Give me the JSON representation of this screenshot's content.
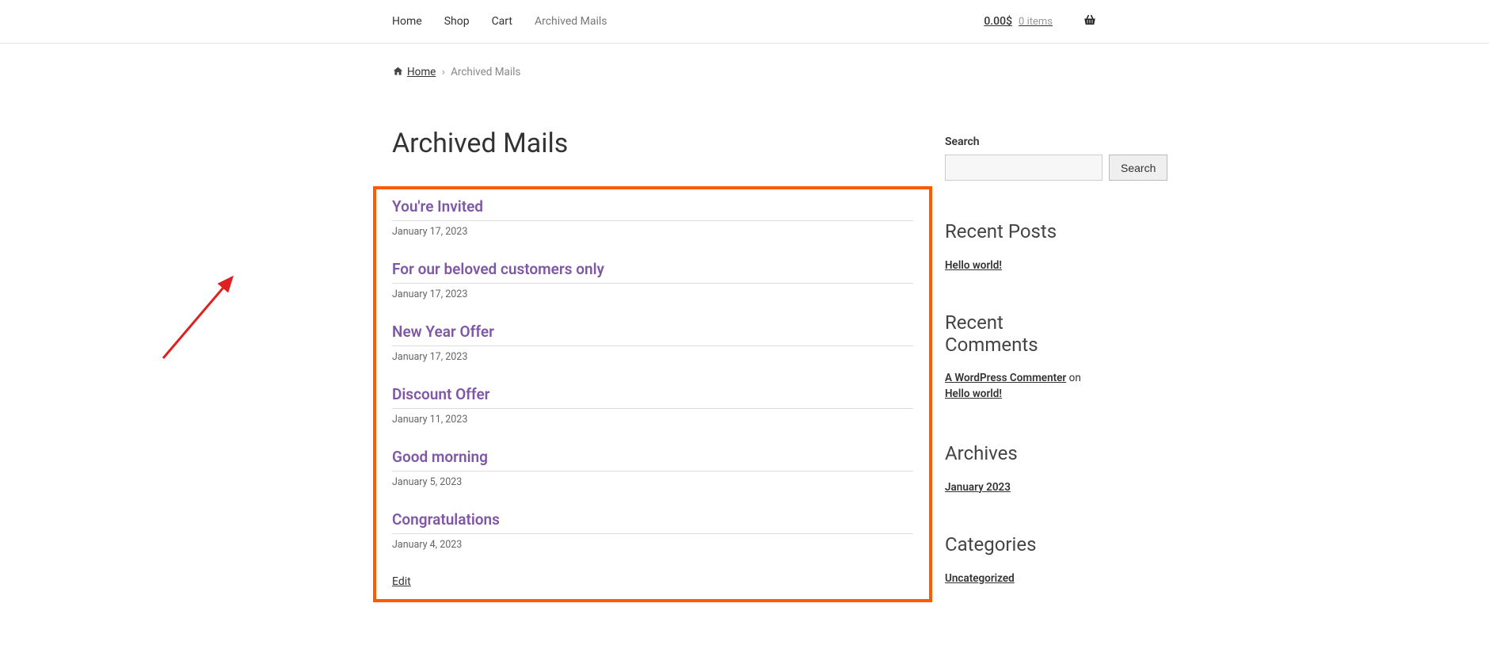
{
  "nav": {
    "home": "Home",
    "shop": "Shop",
    "cart": "Cart",
    "archived_mails": "Archived Mails"
  },
  "cart": {
    "amount": "0.00$",
    "items": "0 items"
  },
  "breadcrumb": {
    "home": "Home",
    "current": "Archived Mails"
  },
  "page_title": "Archived Mails",
  "posts": [
    {
      "title": "You're Invited",
      "date": "January 17, 2023"
    },
    {
      "title": "For our beloved customers only",
      "date": "January 17, 2023"
    },
    {
      "title": "New Year Offer",
      "date": "January 17, 2023"
    },
    {
      "title": "Discount Offer",
      "date": "January 11, 2023"
    },
    {
      "title": "Good morning",
      "date": "January 5, 2023"
    },
    {
      "title": "Congratulations",
      "date": "January 4, 2023"
    }
  ],
  "edit": "Edit",
  "sidebar": {
    "search_label": "Search",
    "search_button": "Search",
    "recent_posts_title": "Recent Posts",
    "recent_post_link": "Hello world!",
    "recent_comments_title": "Recent Comments",
    "commenter": "A WordPress Commenter",
    "on": " on ",
    "comment_post": "Hello world!",
    "archives_title": "Archives",
    "archive_link": "January 2023",
    "categories_title": "Categories",
    "category_link": "Uncategorized"
  }
}
